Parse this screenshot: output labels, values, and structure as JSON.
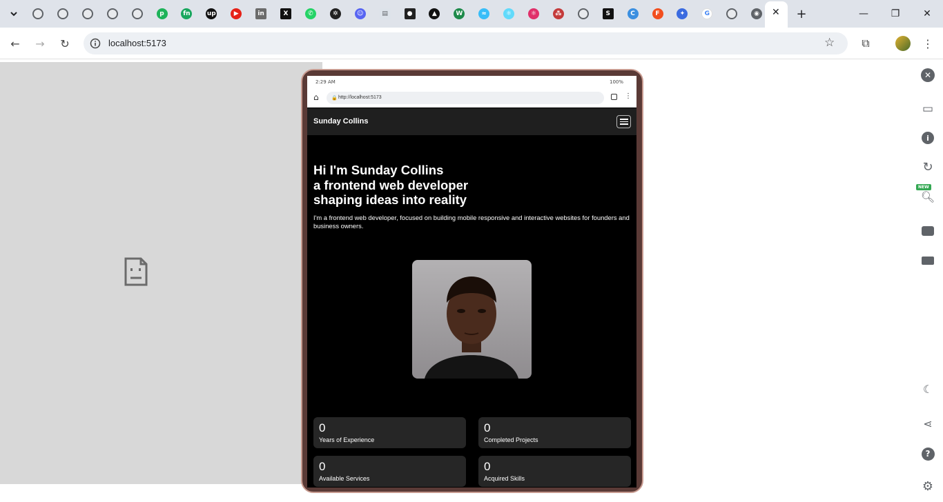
{
  "browser": {
    "address": "localhost:5173",
    "tabs": [
      {
        "icon": "globe-icon"
      },
      {
        "icon": "globe-icon"
      },
      {
        "icon": "globe-icon"
      },
      {
        "icon": "globe-icon"
      },
      {
        "icon": "globe-icon"
      },
      {
        "icon": "p-green-icon"
      },
      {
        "icon": "fn-green-icon"
      },
      {
        "icon": "upwork-icon"
      },
      {
        "icon": "youtube-icon"
      },
      {
        "icon": "linkedin-icon"
      },
      {
        "icon": "x-icon"
      },
      {
        "icon": "whatsapp-icon"
      },
      {
        "icon": "chatgpt-icon"
      },
      {
        "icon": "discord-icon"
      },
      {
        "icon": "doc-icon"
      },
      {
        "icon": "github-icon"
      },
      {
        "icon": "vercel-icon"
      },
      {
        "icon": "w-icon"
      },
      {
        "icon": "tailwind-icon"
      },
      {
        "icon": "react-icon"
      },
      {
        "icon": "react-pink-icon"
      },
      {
        "icon": "dots-icon"
      },
      {
        "icon": "globe-icon"
      },
      {
        "icon": "s-icon"
      },
      {
        "icon": "canva-icon"
      },
      {
        "icon": "figma-icon"
      },
      {
        "icon": "puzzle-icon"
      },
      {
        "icon": "google-icon"
      },
      {
        "icon": "globe-icon"
      },
      {
        "icon": "chrome-icon"
      }
    ]
  },
  "device": {
    "time": "2:29 AM",
    "battery": "100%",
    "url": "http://localhost:5173"
  },
  "site": {
    "brand": "Sunday Collins",
    "hero_lines": [
      "Hi I'm Sunday Collins",
      "a frontend web developer",
      "shaping ideas into reality"
    ],
    "subtitle": "I'm a frontend web developer, focused on building mobile responsive and interactive websites for founders and business owners.",
    "stats": [
      {
        "value": "0",
        "label": "Years of Experience"
      },
      {
        "value": "0",
        "label": "Completed Projects"
      },
      {
        "value": "0",
        "label": "Available Services"
      },
      {
        "value": "0",
        "label": "Acquired Skills"
      }
    ]
  },
  "devtools": {
    "new_badge": "NEW"
  }
}
